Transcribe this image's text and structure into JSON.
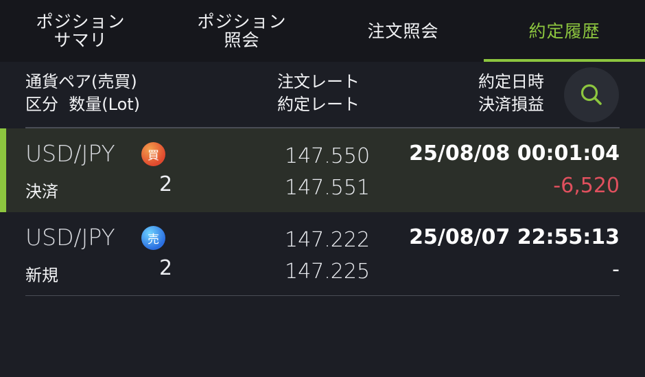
{
  "tabs": [
    {
      "label": "ポジション\nサマリ",
      "active": false
    },
    {
      "label": "ポジション\n照会",
      "active": false
    },
    {
      "label": "注文照会",
      "active": false
    },
    {
      "label": "約定履歴",
      "active": true
    }
  ],
  "header": {
    "col1_line1": "通貨ペア(売買)",
    "col1_line2": "区分  数量(Lot)",
    "col2_line1": "注文レート",
    "col2_line2": "約定レート",
    "col3_line1": "約定日時",
    "col3_line2": "決済損益",
    "search_icon": "search-icon"
  },
  "colors": {
    "accent": "#8dc63f",
    "loss": "#e0505e"
  },
  "rows": [
    {
      "pair": "USD/JPY",
      "side": "買",
      "category": "決済",
      "quantity": "2",
      "order_rate": "147.550",
      "exec_rate": "147.551",
      "datetime": "25/08/08 00:01:04",
      "pl": "-6,520",
      "selected": true
    },
    {
      "pair": "USD/JPY",
      "side": "売",
      "category": "新規",
      "quantity": "2",
      "order_rate": "147.222",
      "exec_rate": "147.225",
      "datetime": "25/08/07 22:55:13",
      "pl": "-",
      "selected": false
    }
  ]
}
